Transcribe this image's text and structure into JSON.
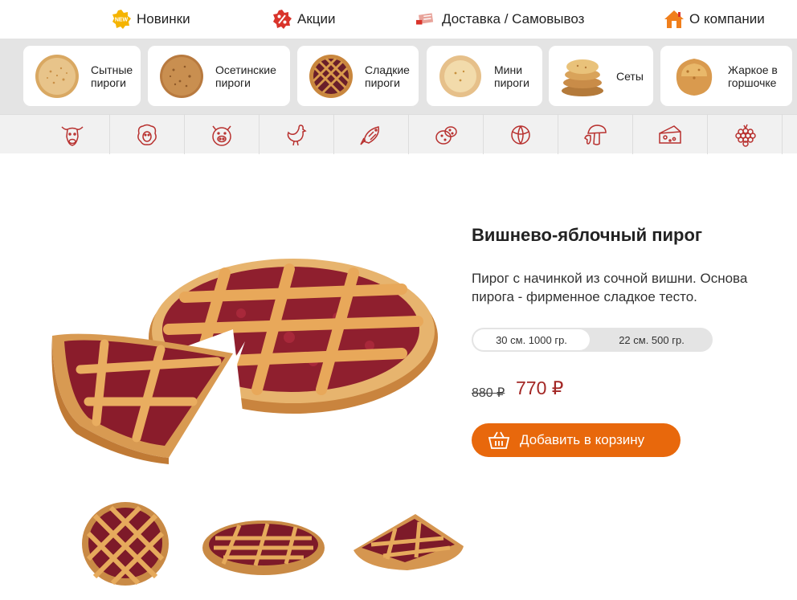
{
  "top_nav": {
    "new_badge": "NEW",
    "items": [
      {
        "label": "Новинки",
        "icon": "new-badge-icon"
      },
      {
        "label": "Акции",
        "icon": "percent-icon"
      },
      {
        "label": "Доставка / Самовывоз",
        "icon": "delivery-icon"
      },
      {
        "label": "О компании",
        "icon": "home-icon"
      }
    ]
  },
  "categories": [
    {
      "label": "Сытные\nпироги"
    },
    {
      "label": "Осетинские\nпироги"
    },
    {
      "label": "Сладкие\nпироги"
    },
    {
      "label": "Мини\nпироги"
    },
    {
      "label": "Сеты"
    },
    {
      "label": "Жаркое в\nгоршочке"
    }
  ],
  "fillings": [
    "beef-icon",
    "lamb-icon",
    "pork-icon",
    "chicken-icon",
    "fish-icon",
    "potato-icon",
    "cabbage-icon",
    "mushroom-icon",
    "cheese-icon",
    "berry-icon"
  ],
  "product": {
    "title": "Вишнево-яблочный пирог",
    "description": "Пирог с начинкой из сочной вишни. Основа пирога - фирменное сладкое тесто.",
    "sizes": [
      "30 см. 1000 гр.",
      "22 см. 500 гр."
    ],
    "selected_size": "30 см. 1000 гр.",
    "old_price": "880 ₽",
    "price": "770 ₽",
    "add_to_cart": "Добавить в корзину"
  },
  "colors": {
    "accent_orange": "#e8680c",
    "price_red": "#a32725",
    "icon_red": "#b8312f",
    "strip_gray": "#e4e4e4"
  }
}
